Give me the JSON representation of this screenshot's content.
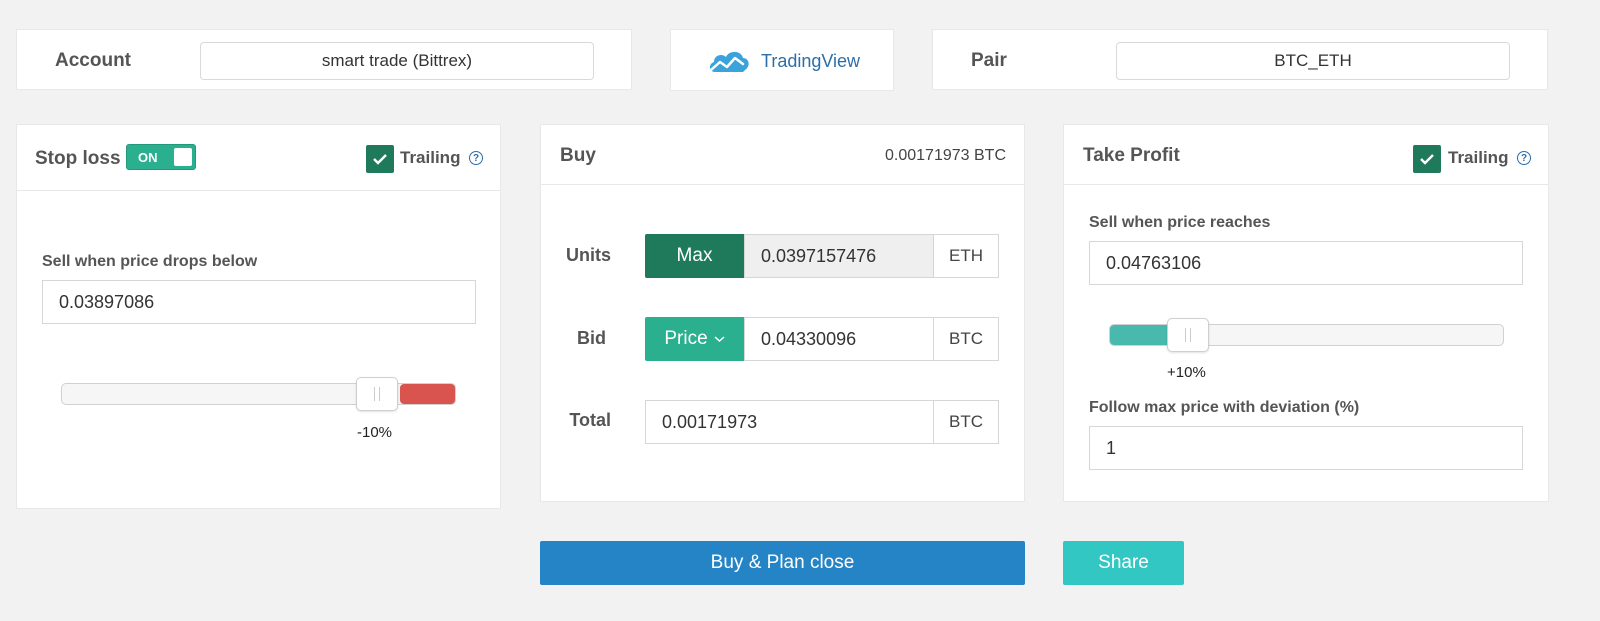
{
  "top": {
    "account_label": "Account",
    "account_value": "smart trade (Bittrex)",
    "tradingview_label": "TradingView",
    "pair_label": "Pair",
    "pair_value": "BTC_ETH"
  },
  "stop_loss": {
    "title": "Stop loss",
    "toggle_label": "ON",
    "toggle_on": true,
    "trailing_label": "Trailing",
    "trailing_checked": true,
    "help_glyph": "?",
    "field_label": "Sell when price drops below",
    "price": "0.03897086",
    "slider_label": "-10%",
    "slider_value_percent": -10,
    "fill_color": "#d9534f"
  },
  "buy": {
    "title": "Buy",
    "total_btc": "0.00171973 BTC",
    "units_label": "Units",
    "max_button": "Max",
    "units_value": "0.0397157476",
    "units_unit": "ETH",
    "bid_label": "Bid",
    "price_button": "Price",
    "bid_value": "0.04330096",
    "bid_unit": "BTC",
    "total_label": "Total",
    "total_value": "0.00171973",
    "total_unit": "BTC"
  },
  "take_profit": {
    "title": "Take Profit",
    "trailing_label": "Trailing",
    "trailing_checked": true,
    "help_glyph": "?",
    "field_label": "Sell when price reaches",
    "price": "0.04763106",
    "slider_label": "+10%",
    "slider_value_percent": 10,
    "fill_color": "#4ab9ad",
    "deviation_label": "Follow max price with deviation (%)",
    "deviation_value": "1"
  },
  "actions": {
    "buy_plan_label": "Buy & Plan close",
    "share_label": "Share"
  },
  "colors": {
    "primary_blue": "#2484c6",
    "green_dark": "#1f7a5b",
    "green": "#2bb08f",
    "teal": "#33c7c3",
    "red": "#d9534f",
    "link_blue": "#2c6ea8"
  }
}
